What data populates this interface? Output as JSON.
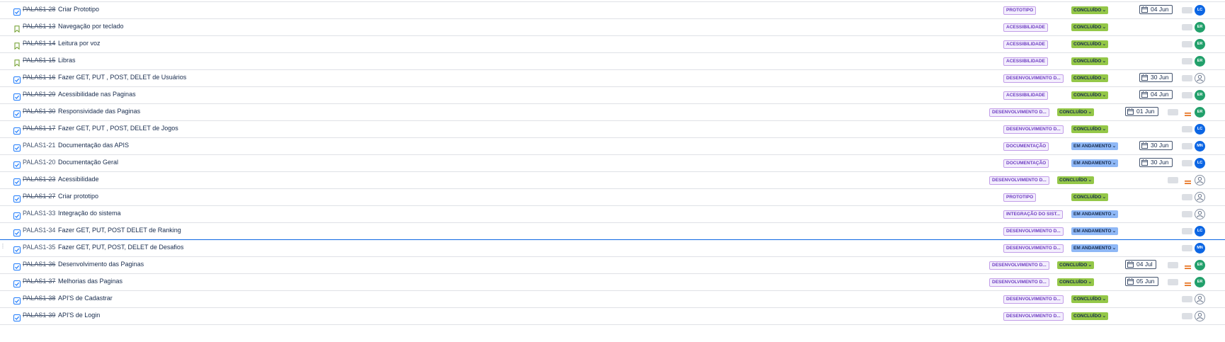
{
  "colors": {
    "epic_border": "#c29ee8",
    "epic_text": "#6e3cc2",
    "done": "#94c748",
    "in_progress": "#8fb8f6",
    "avatar_green": "#22a06b",
    "avatar_blue": "#0c66e4",
    "priority_medium": "#e56910",
    "story_icon": "#6a9a23",
    "task_icon": "#1d7afc"
  },
  "rows": [
    {
      "type": "task-icon",
      "key": "PALAS1-28",
      "key_done": true,
      "summary": "Criar Prototipo",
      "epic": "PROTOTIPO",
      "epic_pos": "a",
      "status": "CONCLUÍDO",
      "status_kind": "done",
      "status_pos": "a",
      "date": "04 Jun",
      "date_pos": "a",
      "estimate_pos": "a",
      "priority": null,
      "avatar": "LC",
      "avatar_kind": "blue"
    },
    {
      "type": "story-icon",
      "key": "PALAS1-13",
      "key_done": true,
      "summary": "Navegação por teclado",
      "epic": "ACESSIBILIDADE",
      "epic_pos": "a",
      "status": "CONCLUÍDO",
      "status_kind": "done",
      "status_pos": "a",
      "date": null,
      "estimate_pos": "a",
      "priority": null,
      "avatar": "ER",
      "avatar_kind": "green"
    },
    {
      "type": "story-icon",
      "key": "PALAS1-14",
      "key_done": true,
      "summary": "Leitura por voz",
      "epic": "ACESSIBILIDADE",
      "epic_pos": "a",
      "status": "CONCLUÍDO",
      "status_kind": "done",
      "status_pos": "a",
      "date": null,
      "estimate_pos": "a",
      "priority": null,
      "avatar": "ER",
      "avatar_kind": "green"
    },
    {
      "type": "story-icon",
      "key": "PALAS1-15",
      "key_done": true,
      "summary": "Libras",
      "epic": "ACESSIBILIDADE",
      "epic_pos": "a",
      "status": "CONCLUÍDO",
      "status_kind": "done",
      "status_pos": "a",
      "date": null,
      "estimate_pos": "a",
      "priority": null,
      "avatar": "ER",
      "avatar_kind": "green"
    },
    {
      "type": "task-icon",
      "key": "PALAS1-16",
      "key_done": true,
      "summary": "Fazer GET, PUT , POST, DELET de Usuários",
      "epic": "DESENVOLVIMENTO D...",
      "epic_pos": "a",
      "status": "CONCLUÍDO",
      "status_kind": "done",
      "status_pos": "a",
      "date": "30 Jun",
      "date_pos": "a",
      "estimate_pos": "a",
      "priority": null,
      "avatar": "",
      "avatar_kind": "none"
    },
    {
      "type": "task-icon",
      "key": "PALAS1-29",
      "key_done": true,
      "summary": "Acessibilidade nas Paginas",
      "epic": "ACESSIBILIDADE",
      "epic_pos": "a",
      "status": "CONCLUÍDO",
      "status_kind": "done",
      "status_pos": "a",
      "date": "04 Jun",
      "date_pos": "a",
      "estimate_pos": "a",
      "priority": null,
      "avatar": "ER",
      "avatar_kind": "green"
    },
    {
      "type": "task-icon",
      "key": "PALAS1-30",
      "key_done": true,
      "summary": "Responsividade das Paginas",
      "epic": "DESENVOLVIMENTO D...",
      "epic_pos": "b",
      "status": "CONCLUÍDO",
      "status_kind": "done",
      "status_pos": "b",
      "date": "01 Jun",
      "date_pos": "b",
      "estimate_pos": "b",
      "priority": "medium",
      "avatar": "ER",
      "avatar_kind": "green"
    },
    {
      "type": "task-icon",
      "key": "PALAS1-17",
      "key_done": true,
      "summary": "Fazer GET, PUT , POST, DELET de Jogos",
      "epic": "DESENVOLVIMENTO D...",
      "epic_pos": "a",
      "status": "CONCLUÍDO",
      "status_kind": "done",
      "status_pos": "a",
      "date": null,
      "estimate_pos": "a",
      "priority": null,
      "avatar": "LC",
      "avatar_kind": "blue"
    },
    {
      "type": "task-icon",
      "key": "PALAS1-21",
      "key_done": false,
      "summary": "Documentação das APIS",
      "epic": "DOCUMENTAÇÃO",
      "epic_pos": "a",
      "status": "EM ANDAMENTO",
      "status_kind": "prog",
      "status_pos": "a",
      "date": "30 Jun",
      "date_pos": "a",
      "estimate_pos": "a",
      "priority": null,
      "avatar": "MN",
      "avatar_kind": "blue"
    },
    {
      "type": "task-icon",
      "key": "PALAS1-20",
      "key_done": false,
      "summary": "Documentação Geral",
      "epic": "DOCUMENTAÇÃO",
      "epic_pos": "a",
      "status": "EM ANDAMENTO",
      "status_kind": "prog",
      "status_pos": "a",
      "date": "30 Jun",
      "date_pos": "a",
      "estimate_pos": "a",
      "priority": null,
      "avatar": "LC",
      "avatar_kind": "blue"
    },
    {
      "type": "task-icon",
      "key": "PALAS1-23",
      "key_done": true,
      "summary": "Acessibilidade",
      "epic": "DESENVOLVIMENTO D...",
      "epic_pos": "b",
      "status": "CONCLUÍDO",
      "status_kind": "done",
      "status_pos": "b",
      "date": null,
      "estimate_pos": "b",
      "priority": "medium",
      "avatar": "",
      "avatar_kind": "none"
    },
    {
      "type": "task-icon",
      "key": "PALAS1-27",
      "key_done": true,
      "summary": "Criar prototipo",
      "epic": "PROTOTIPO",
      "epic_pos": "a",
      "status": "CONCLUÍDO",
      "status_kind": "done",
      "status_pos": "a",
      "date": null,
      "estimate_pos": "a",
      "priority": null,
      "avatar": "",
      "avatar_kind": "none"
    },
    {
      "type": "task-icon",
      "key": "PALAS1-33",
      "key_done": false,
      "summary": "Integração do sistema",
      "epic": "INTEGRAÇÃO DO SIST...",
      "epic_pos": "a",
      "status": "EM ANDAMENTO",
      "status_kind": "prog",
      "status_pos": "a",
      "date": null,
      "estimate_pos": "a",
      "priority": null,
      "avatar": "",
      "avatar_kind": "none"
    },
    {
      "type": "task-icon",
      "key": "PALAS1-34",
      "key_done": false,
      "summary": "Fazer GET, PUT, POST DELET de Ranking",
      "epic": "DESENVOLVIMENTO D...",
      "epic_pos": "a",
      "status": "EM ANDAMENTO",
      "status_kind": "prog",
      "status_pos": "a",
      "date": null,
      "estimate_pos": "a",
      "priority": null,
      "avatar": "LC",
      "avatar_kind": "blue",
      "drop": true
    },
    {
      "type": "task-icon",
      "key": "PALAS1-35",
      "key_done": false,
      "summary": "Fazer GET, PUT, POST, DELET de Desafios",
      "epic": "DESENVOLVIMENTO D...",
      "epic_pos": "a",
      "status": "EM ANDAMENTO",
      "status_kind": "prog",
      "status_pos": "a",
      "date": null,
      "estimate_pos": "a",
      "priority": null,
      "avatar": "MN",
      "avatar_kind": "blue",
      "handle": true
    },
    {
      "type": "task-icon",
      "key": "PALAS1-36",
      "key_done": true,
      "summary": "Desenvolvimento das Paginas",
      "epic": "DESENVOLVIMENTO D...",
      "epic_pos": "b",
      "status": "CONCLUÍDO",
      "status_kind": "done",
      "status_pos": "b",
      "date": "04 Jul",
      "date_pos": "b",
      "estimate_pos": "b",
      "priority": "medium",
      "avatar": "ER",
      "avatar_kind": "green"
    },
    {
      "type": "task-icon",
      "key": "PALAS1-37",
      "key_done": true,
      "summary": "Melhorias das Paginas",
      "epic": "DESENVOLVIMENTO D...",
      "epic_pos": "b",
      "status": "CONCLUÍDO",
      "status_kind": "done",
      "status_pos": "b",
      "date": "05 Jun",
      "date_pos": "b",
      "estimate_pos": "b",
      "priority": "medium",
      "avatar": "ER",
      "avatar_kind": "green"
    },
    {
      "type": "task-icon",
      "key": "PALAS1-38",
      "key_done": true,
      "summary": "API'S de Cadastrar",
      "epic": "DESENVOLVIMENTO D...",
      "epic_pos": "a",
      "status": "CONCLUÍDO",
      "status_kind": "done",
      "status_pos": "a",
      "date": null,
      "estimate_pos": "a",
      "priority": null,
      "avatar": "",
      "avatar_kind": "none"
    },
    {
      "type": "task-icon",
      "key": "PALAS1-39",
      "key_done": true,
      "summary": "API'S de Login",
      "epic": "DESENVOLVIMENTO D...",
      "epic_pos": "a",
      "status": "CONCLUÍDO",
      "status_kind": "done",
      "status_pos": "a",
      "date": null,
      "estimate_pos": "a",
      "priority": null,
      "avatar": "",
      "avatar_kind": "none"
    }
  ]
}
